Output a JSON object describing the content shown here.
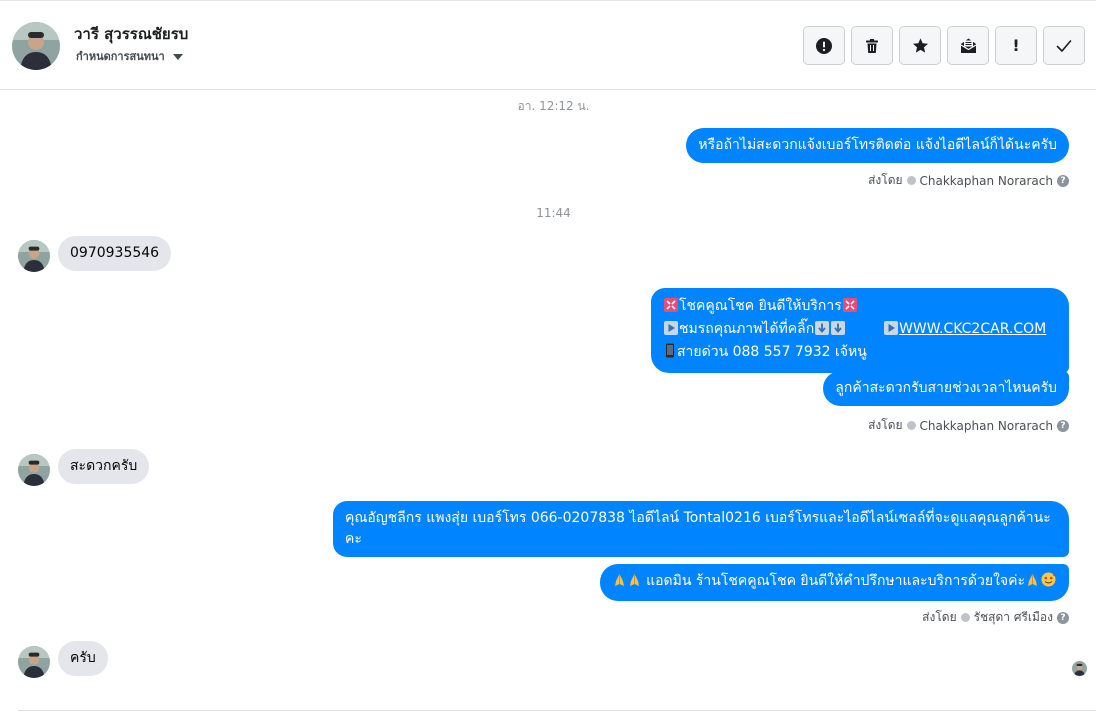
{
  "header": {
    "name": "วารี สุวรรณชัยรบ",
    "subtitle": "กำหนดการสนทนา"
  },
  "toolbar": {
    "buttons": [
      {
        "icon": "info-circle-icon",
        "label": ""
      },
      {
        "icon": "trash-icon",
        "label": ""
      },
      {
        "icon": "star-icon",
        "label": ""
      },
      {
        "icon": "mail-open-icon",
        "label": ""
      },
      {
        "icon": "exclamation-icon",
        "label": "!"
      },
      {
        "icon": "check-icon",
        "label": ""
      }
    ]
  },
  "conversation": {
    "timestamps": [
      "อา. 12:12 น.",
      "11:44"
    ],
    "messages": {
      "out_1": "หรือถ้าไม่สะดวกแจ้งเบอร์โทรติดต่อ แจ้งไอดีไลน์ก็ได้นะครับ",
      "in_1": "0970935546",
      "out_2": {
        "line1": "โชคคูณโชค ยินดีให้บริการ",
        "line2a": "ชมรถคุณภาพได้ที่คลิ๊ก",
        "line2b": "WWW.CKC2CAR.COM",
        "line3": "สายด่วน 088 557 7932 เจ้หนู"
      },
      "out_3": "ลูกค้าสะดวกรับสายช่วงเวลาไหนครับ",
      "in_2": "สะดวกครับ",
      "out_4": "คุณอัญชลีกร แพงสุ่ย      เบอร์โทร 066-0207838 ไอดีไลน์ Tontal0216   เบอร์โทรและไอดีไลน์เซลล์ที่จะดูแลคุณลูกค้านะคะ",
      "out_5": "แอดมิน ร้านโชคคูณโชค ยินดีให้คำปรึกษาและบริการด้วยใจค่ะ",
      "in_3": "ครับ"
    },
    "sent_by": [
      {
        "prefix": "ส่งโดย",
        "name": "Chakkaphan Norarach"
      },
      {
        "prefix": "ส่งโดย",
        "name": "Chakkaphan Norarach"
      },
      {
        "prefix": "ส่งโดย",
        "name": "รัชสุดา ศรีเมือง"
      }
    ],
    "help_icon_text": "?"
  },
  "colors": {
    "outgoing": "#0084ff",
    "incoming": "#e4e6eb"
  }
}
